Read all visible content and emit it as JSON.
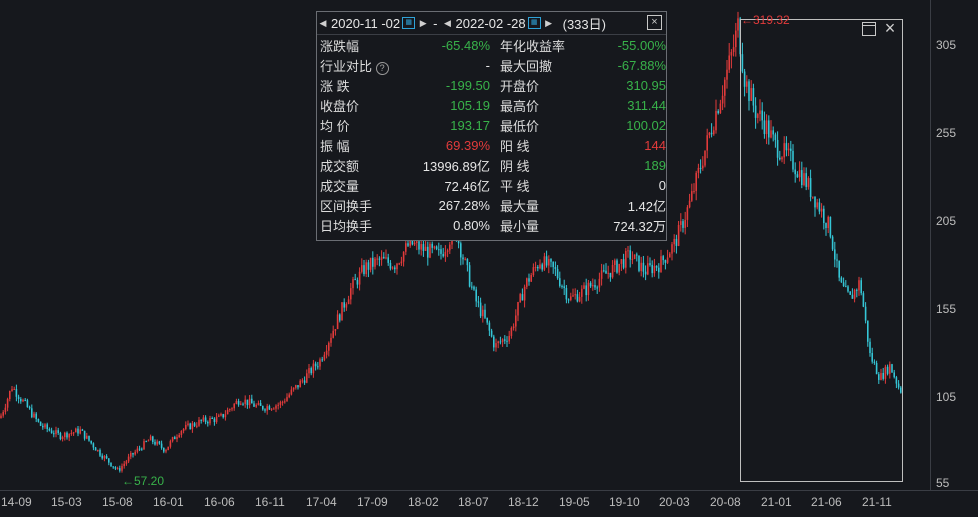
{
  "chart_data": {
    "type": "candlestick",
    "y_ticks": [
      "305",
      "255",
      "205",
      "155",
      "105",
      "55"
    ],
    "x_ticks": [
      "14-09",
      "15-03",
      "15-08",
      "16-01",
      "16-06",
      "16-11",
      "17-04",
      "17-09",
      "18-02",
      "18-07",
      "18-12",
      "19-05",
      "19-10",
      "20-03",
      "20-08",
      "21-01",
      "21-06",
      "21-11"
    ],
    "ylim": [
      50,
      318
    ],
    "trend_points": [
      [
        0,
        92
      ],
      [
        12,
        110
      ],
      [
        25,
        100
      ],
      [
        40,
        88
      ],
      [
        60,
        82
      ],
      [
        80,
        85
      ],
      [
        100,
        72
      ],
      [
        118,
        62
      ],
      [
        130,
        70
      ],
      [
        150,
        80
      ],
      [
        165,
        74
      ],
      [
        180,
        85
      ],
      [
        200,
        90
      ],
      [
        220,
        92
      ],
      [
        240,
        103
      ],
      [
        260,
        98
      ],
      [
        280,
        100
      ],
      [
        300,
        112
      ],
      [
        320,
        125
      ],
      [
        335,
        145
      ],
      [
        350,
        165
      ],
      [
        365,
        178
      ],
      [
        380,
        182
      ],
      [
        395,
        180
      ],
      [
        410,
        192
      ],
      [
        425,
        188
      ],
      [
        440,
        185
      ],
      [
        455,
        200
      ],
      [
        465,
        180
      ],
      [
        475,
        160
      ],
      [
        485,
        148
      ],
      [
        495,
        133
      ],
      [
        510,
        140
      ],
      [
        525,
        168
      ],
      [
        540,
        182
      ],
      [
        555,
        176
      ],
      [
        570,
        160
      ],
      [
        585,
        165
      ],
      [
        600,
        172
      ],
      [
        615,
        178
      ],
      [
        630,
        185
      ],
      [
        645,
        176
      ],
      [
        660,
        180
      ],
      [
        675,
        192
      ],
      [
        690,
        215
      ],
      [
        705,
        245
      ],
      [
        720,
        275
      ],
      [
        732,
        300
      ],
      [
        738,
        316
      ],
      [
        745,
        285
      ],
      [
        755,
        268
      ],
      [
        765,
        260
      ],
      [
        775,
        248
      ],
      [
        790,
        240
      ],
      [
        805,
        228
      ],
      [
        820,
        212
      ],
      [
        830,
        200
      ],
      [
        840,
        168
      ],
      [
        850,
        160
      ],
      [
        860,
        170
      ],
      [
        870,
        128
      ],
      [
        880,
        115
      ],
      [
        890,
        122
      ],
      [
        900,
        108
      ]
    ],
    "low_marker": "57.20",
    "high_marker": "319.32"
  },
  "panel": {
    "start_date": "2020-11 -02",
    "end_date": "2022-02 -28",
    "separator": "-",
    "days": "(333日)",
    "rows": [
      {
        "l1": "涨跌幅",
        "v1": "-65.48%",
        "c1": "green",
        "l2": "年化收益率",
        "v2": "-55.00%",
        "c2": "green"
      },
      {
        "l1": "行业对比",
        "v1": "-",
        "c1": "white",
        "l2": "最大回撤",
        "v2": "-67.88%",
        "c2": "green"
      },
      {
        "l1": "涨    跌",
        "v1": "-199.50",
        "c1": "green",
        "l2": "开盘价",
        "v2": "310.95",
        "c2": "green"
      },
      {
        "l1": "收盘价",
        "v1": "105.19",
        "c1": "green",
        "l2": "最高价",
        "v2": "311.44",
        "c2": "green"
      },
      {
        "l1": "均    价",
        "v1": "193.17",
        "c1": "green",
        "l2": "最低价",
        "v2": "100.02",
        "c2": "green"
      },
      {
        "l1": "振    幅",
        "v1": "69.39%",
        "c1": "red",
        "l2": "阳    线",
        "v2": "144",
        "c2": "red"
      },
      {
        "l1": "成交额",
        "v1": "13996.89亿",
        "c1": "white",
        "l2": "阴    线",
        "v2": "189",
        "c2": "green"
      },
      {
        "l1": "成交量",
        "v1": "72.46亿",
        "c1": "white",
        "l2": "平    线",
        "v2": "0",
        "c2": "white"
      },
      {
        "l1": "区间换手",
        "v1": "267.28%",
        "c1": "white",
        "l2": "最大量",
        "v2": "1.42亿",
        "c2": "white"
      },
      {
        "l1": "日均换手",
        "v1": "0.80%",
        "c1": "white",
        "l2": "最小量",
        "v2": "724.32万",
        "c2": "white"
      }
    ]
  },
  "icons": {
    "prev": "◀",
    "next": "▶",
    "calendar": "▦",
    "close": "×",
    "help": "?"
  },
  "colors": {
    "up": "#e23b3b",
    "down": "#35c6d6",
    "bg": "#16181d"
  }
}
